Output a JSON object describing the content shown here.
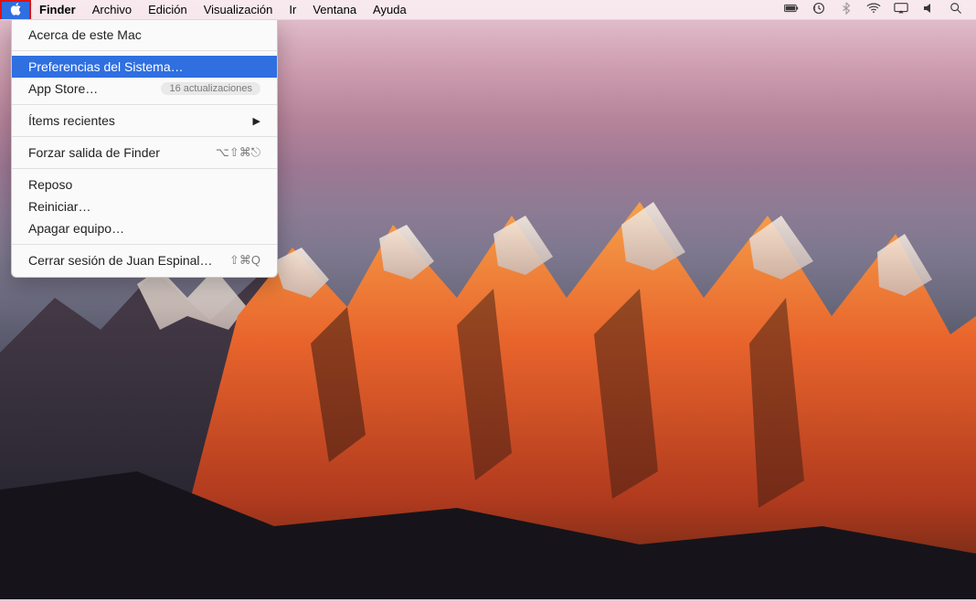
{
  "menubar": {
    "app": "Finder",
    "items": [
      "Archivo",
      "Edición",
      "Visualización",
      "Ir",
      "Ventana",
      "Ayuda"
    ]
  },
  "apple_menu": {
    "about": "Acerca de este Mac",
    "system_prefs": "Preferencias del Sistema…",
    "app_store": {
      "label": "App Store…",
      "badge": "16 actualizaciones"
    },
    "recent_items": "Ítems recientes",
    "force_quit": {
      "label": "Forzar salida de Finder",
      "shortcut": "⌥⇧⌘⎋"
    },
    "sleep": "Reposo",
    "restart": "Reiniciar…",
    "shutdown": "Apagar equipo…",
    "logout": {
      "label": "Cerrar sesión de Juan Espinal…",
      "shortcut": "⇧⌘Q"
    }
  }
}
